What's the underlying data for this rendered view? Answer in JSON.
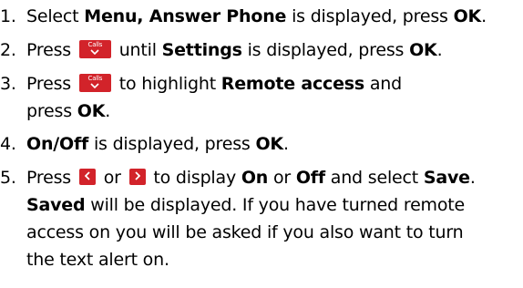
{
  "steps": [
    {
      "num": "1.",
      "t1": "Select ",
      "b1": "Menu, Answer Phone",
      "t2": " is displayed, press ",
      "b2": "OK",
      "t3": "."
    },
    {
      "num": "2.",
      "t1": "Press ",
      "key": "Calls",
      "t2": " until ",
      "b1": "Settings",
      "t3": " is displayed, press ",
      "b2": "OK",
      "t4": "."
    },
    {
      "num": "3.",
      "t1": "Press ",
      "key": "Calls",
      "t2": " to highlight ",
      "b1": "Remote access",
      "t3": " and",
      "l2_t1": "press ",
      "l2_b1": "OK",
      "l2_t2": "."
    },
    {
      "num": "4.",
      "b1": "On/Off",
      "t1": " is displayed, press ",
      "b2": "OK",
      "t2": "."
    },
    {
      "num": "5.",
      "t1": "Press ",
      "t2": " or ",
      "t3": " to display ",
      "b1": "On",
      "t4": " or ",
      "b2": "Off",
      "t5": " and select ",
      "b3": "Save",
      "t6": ".",
      "l2_b1": "Saved",
      "l2_t1": " will be displayed. If you have turned remote",
      "l3": "access on you will be asked if you also want to turn",
      "l4": "the text alert on."
    }
  ],
  "icons": {
    "calls_key": "calls-key-icon",
    "left_key": "left-arrow-key-icon",
    "right_key": "right-arrow-key-icon"
  },
  "colors": {
    "key_background": "#d2232a",
    "key_foreground": "#ffffff",
    "text": "#000000"
  }
}
